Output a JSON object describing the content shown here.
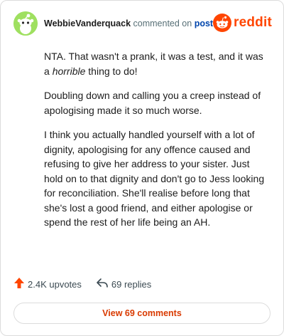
{
  "header": {
    "username": "WebbieVanderquack",
    "action_text": "commented on",
    "post_link": "post",
    "brand": "reddit"
  },
  "comment": {
    "p1_a": "NTA. That wasn't a prank, it was a test, and it was a ",
    "p1_em": "horrible",
    "p1_b": " thing to do!",
    "p2": "Doubling down and calling you a creep instead of apologising made it so much worse.",
    "p3": "I think you actually handled yourself with a lot of dignity, apologising for any offence caused and refusing to give her address to your sister. Just hold on to that dignity and don't go to Jess looking for reconciliation. She'll realise before long that she's lost a good friend, and either apologise or spend the rest of her life being an AH."
  },
  "footer": {
    "upvotes": "2.4K upvotes",
    "replies": "69 replies",
    "view_button": "View 69 comments"
  },
  "colors": {
    "brand": "#ff4500",
    "avatar_bg": "#9fe060",
    "link": "#0045ac",
    "view_button_text": "#d93a00"
  },
  "icons": {
    "avatar": "snoo-avatar-icon",
    "brand": "reddit-logo-icon",
    "upvote": "upvote-arrow-icon",
    "reply": "reply-arrow-icon"
  }
}
